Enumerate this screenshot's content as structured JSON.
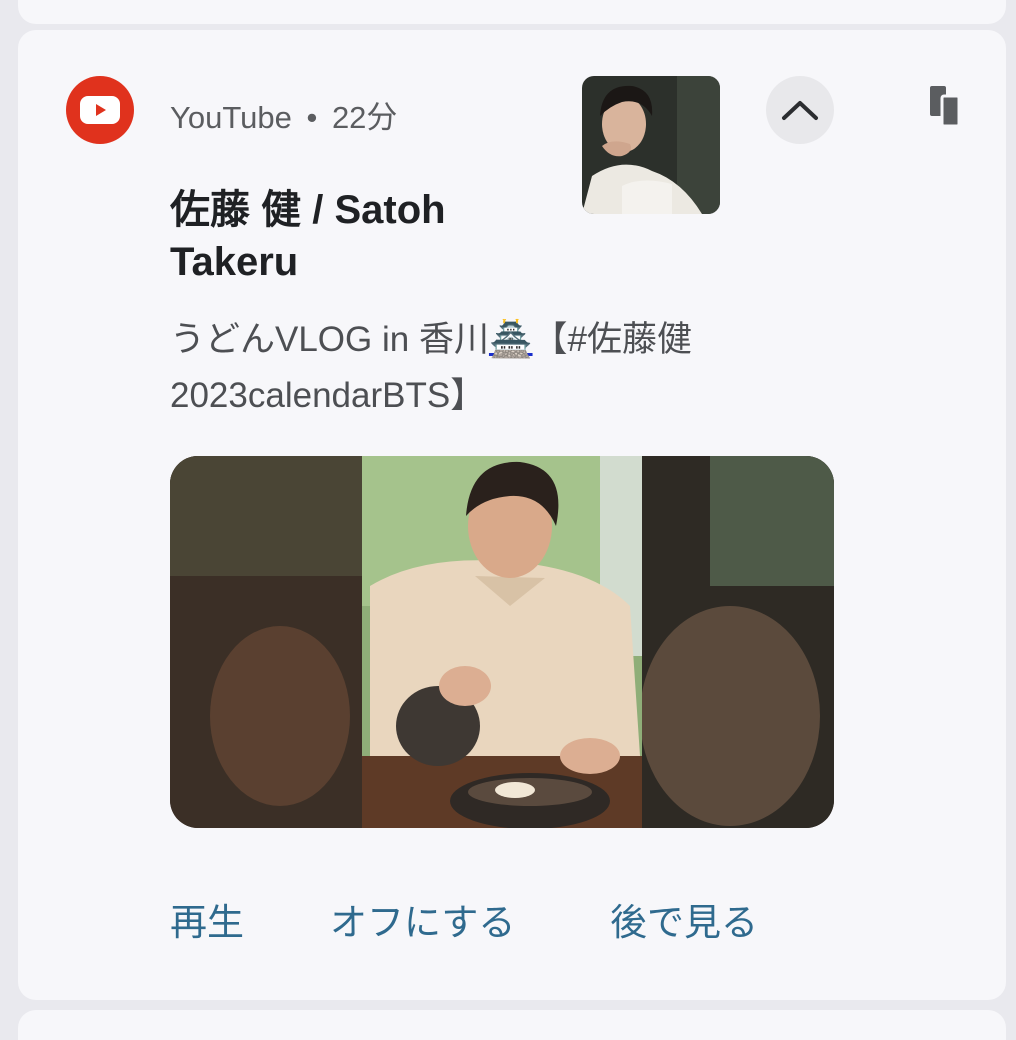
{
  "notification": {
    "app_name": "YouTube",
    "separator": "•",
    "time": "22分",
    "title": "佐藤 健 / Satoh Takeru",
    "body_prefix": "うどんVLOG in 香川",
    "body_emoji": "🏯",
    "body_suffix": "【#佐藤健 2023calendarBTS】",
    "icon": "youtube-logo-icon",
    "accent_color": "#e0321d",
    "action_color": "#2f6a8e"
  },
  "actions": {
    "play_label": "再生",
    "turn_off_label": "オフにする",
    "watch_later_label": "後で見る"
  }
}
